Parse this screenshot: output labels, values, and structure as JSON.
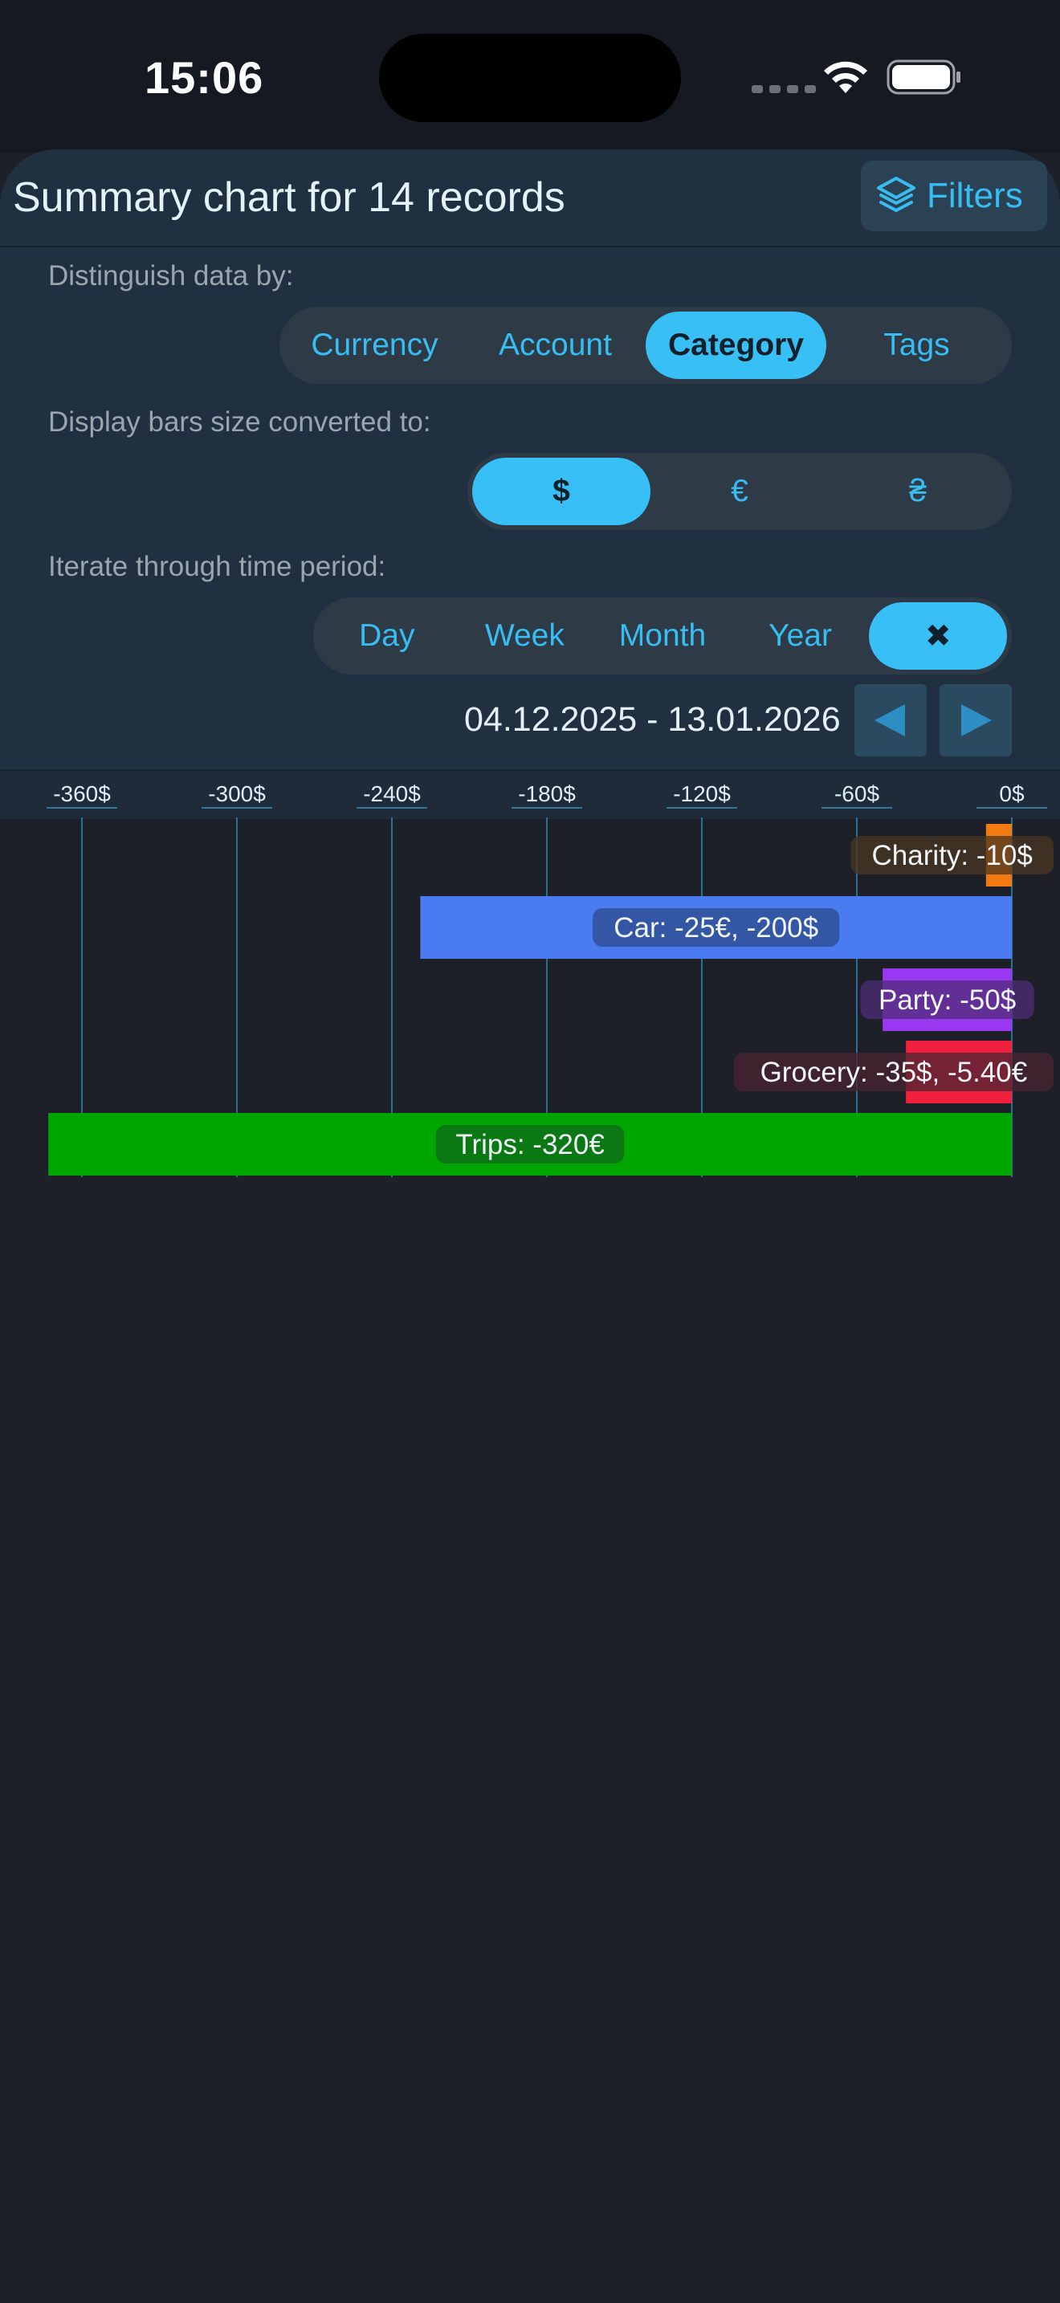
{
  "status_bar": {
    "time": "15:06"
  },
  "header": {
    "title": "Summary chart for 14 records",
    "filters_label": "Filters"
  },
  "distinguish": {
    "label": "Distinguish data by:",
    "options": [
      "Currency",
      "Account",
      "Category",
      "Tags"
    ],
    "selected": "Category"
  },
  "convert": {
    "label": "Display bars size converted to:",
    "options": [
      "$",
      "€",
      "₴"
    ],
    "selected": "$"
  },
  "iterate": {
    "label": "Iterate through time period:",
    "options": [
      "Day",
      "Week",
      "Month",
      "Year",
      "✖"
    ],
    "selected": "✖"
  },
  "period": {
    "range": "04.12.2025 - 13.01.2026"
  },
  "colors": {
    "accent": "#38bff5",
    "charity": "#f27a10",
    "car": "#4a7bf0",
    "party": "#9a37f0",
    "grocery": "#f0203e",
    "trips": "#00a500"
  },
  "chart_data": {
    "type": "bar",
    "orientation": "horizontal",
    "xlim": [
      -360,
      0
    ],
    "x_ticks": [
      "-360$",
      "-300$",
      "-240$",
      "-180$",
      "-120$",
      "-60$",
      "0$"
    ],
    "x_tick_values": [
      -360,
      -300,
      -240,
      -180,
      -120,
      -60,
      0
    ],
    "bars": [
      {
        "label": "Charity: -10$",
        "value": -10,
        "color": "#f27a10"
      },
      {
        "label": "Car: -25€, -200$",
        "value": -229,
        "color": "#4a7bf0"
      },
      {
        "label": "Party: -50$",
        "value": -50,
        "color": "#9a37f0"
      },
      {
        "label": "Grocery: -35$, -5.40€",
        "value": -41,
        "color": "#f0203e"
      },
      {
        "label": "Trips: -320€",
        "value": -373,
        "color": "#00a500"
      }
    ]
  }
}
